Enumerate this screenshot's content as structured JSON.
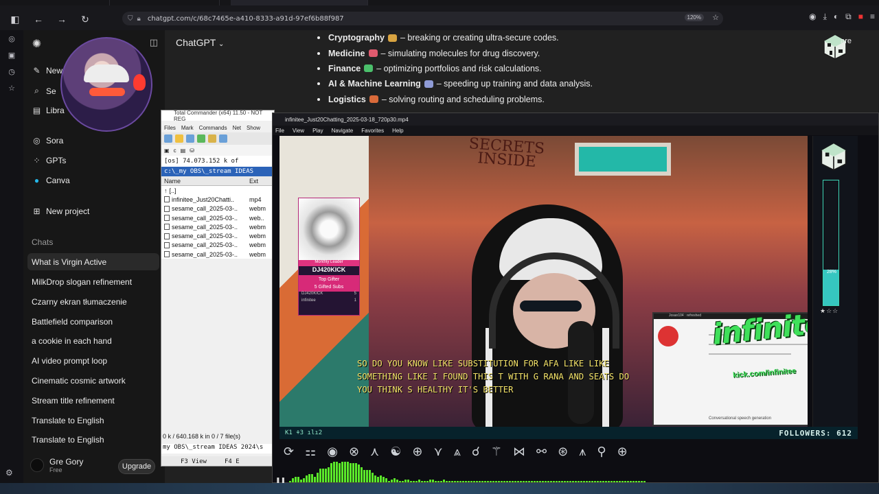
{
  "browser": {
    "url": "chatgpt.com/c/68c7465e-a410-8333-a91d-97ef6b88f987",
    "zoom": "120%"
  },
  "sidebar": {
    "new_chat": "New",
    "search": "Se",
    "library": "Libra",
    "items": [
      "Sora",
      "GPTs",
      "Canva"
    ],
    "new_project": "New project",
    "chats_label": "Chats",
    "chats": [
      "What is Virgin Active",
      "MilkDrop slogan refinement",
      "Czarny ekran tłumaczenie",
      "Battlefield comparison",
      "a cookie in each hand",
      "AI video prompt loop",
      "Cinematic cosmic artwork",
      "Stream title refinement",
      "Translate to English",
      "Translate to English"
    ],
    "user_name": "Gre Gory",
    "user_plan": "Free",
    "upgrade_label": "Upgrade"
  },
  "main": {
    "title": "ChatGPT",
    "share": "are",
    "bullets": [
      {
        "bold": "Cryptography",
        "text": "– breaking or creating ultra-secure codes.",
        "color": "#d9a441"
      },
      {
        "bold": "Medicine",
        "text": "– simulating molecules for drug discovery.",
        "color": "#e05a6e"
      },
      {
        "bold": "Finance",
        "text": "– optimizing portfolios and risk calculations.",
        "color": "#4bbf6b"
      },
      {
        "bold": "AI & Machine Learning",
        "text": "– speeding up training and data analysis.",
        "color": "#8f9bd6"
      },
      {
        "bold": "Logistics",
        "text": "– solving routing and scheduling problems.",
        "color": "#d96a3a"
      }
    ]
  },
  "total_commander": {
    "title": "Total Commander (x64) 11.50 - NOT REG",
    "menu": [
      "Files",
      "Mark",
      "Commands",
      "Net",
      "Show"
    ],
    "drive": "c",
    "free_space": "[os]  74.073.152 k of",
    "path": "c:\\_my OBS\\_stream IDEAS",
    "col_name": "Name",
    "col_ext": "Ext",
    "rows": [
      {
        "name": "[..]",
        "ext": ""
      },
      {
        "name": "infinitee_Just20Chatti..",
        "ext": "mp4"
      },
      {
        "name": "sesame_call_2025-03-..",
        "ext": "webm"
      },
      {
        "name": "sesame_call_2025-03-..",
        "ext": "web.."
      },
      {
        "name": "sesame_call_2025-03-..",
        "ext": "webm"
      },
      {
        "name": "sesame_call_2025-03-..",
        "ext": "webm"
      },
      {
        "name": "sesame_call_2025-03-..",
        "ext": "webm"
      },
      {
        "name": "sesame_call_2025-03-..",
        "ext": "webm"
      }
    ],
    "status": "0 k / 640.168 k in 0 / 7 file(s)",
    "cmdline": "my OBS\\_stream IDEAS 2024\\s",
    "fkey1": "F3 View",
    "fkey2": "F4 E"
  },
  "player": {
    "title": "infinitee_Just20Chatting_2025-03-18_720p30.mp4",
    "menu": [
      "File",
      "View",
      "Play",
      "Navigate",
      "Favorites",
      "Help"
    ]
  },
  "stream": {
    "sign_line1": "SECRETS",
    "sign_line2": "INSIDE",
    "leader_label": "Monthly Leader",
    "leader_name": "DJ420KICK",
    "top_gifter_line1": "Top Gifter",
    "top_gifter_line2": "5 Gifted Subs",
    "leader_rows": [
      {
        "name": "DJ420KICK",
        "val": "5"
      },
      {
        "name": "infinitee",
        "val": "1"
      }
    ],
    "caption": "SO DO YOU KNOW LIKE SUBSTITUTION FOR AFA LIKE LIKE SOMETHING LIKE I FOUND THIS T WITH G RANA AND SEATS DO YOU THINK S HEALTHY IT'S BETTER",
    "pip_bar": "Josan104 : refreshed",
    "pip_footer": "Conversational speech generation",
    "brand": "infinitee",
    "brand_url": "kick.com/infinitee",
    "meter_pct": "28%",
    "meter_value": 0.28,
    "hud_left": "K1  ⚘3  ılı2",
    "followers": "FOLLOWERS: 612",
    "glyphs": [
      "⟳",
      "⚏",
      "◉",
      "⊗",
      "⋏",
      "☯",
      "⊕",
      "⋎",
      "⩓",
      "☌",
      "⚚",
      "⋈",
      "⚯",
      "⊛",
      "⩚",
      "⚲",
      "⊕"
    ]
  }
}
